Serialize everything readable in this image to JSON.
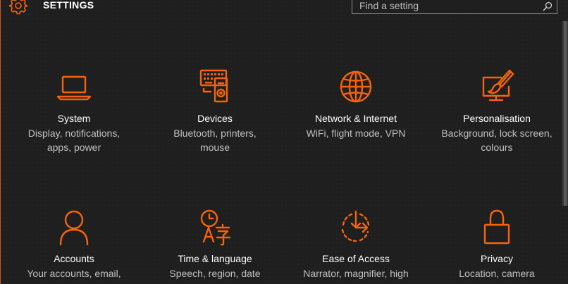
{
  "header": {
    "title": "SETTINGS",
    "gear_icon": "gear-icon"
  },
  "search": {
    "placeholder": "Find a setting",
    "icon": "search-icon"
  },
  "accent_color": "#f7630c",
  "tiles": [
    {
      "title": "System",
      "description": "Display, notifications, apps, power",
      "icon": "laptop-icon"
    },
    {
      "title": "Devices",
      "description": "Bluetooth, printers, mouse",
      "icon": "devices-icon"
    },
    {
      "title": "Network & Internet",
      "description": "WiFi, flight mode, VPN",
      "icon": "globe-icon"
    },
    {
      "title": "Personalisation",
      "description": "Background, lock screen, colours",
      "icon": "paintbrush-icon"
    },
    {
      "title": "Accounts",
      "description": "Your accounts, email, sync, work, other users",
      "icon": "person-icon"
    },
    {
      "title": "Time & language",
      "description": "Speech, region, date",
      "icon": "clock-language-icon"
    },
    {
      "title": "Ease of Access",
      "description": "Narrator, magnifier, high contrast",
      "icon": "ease-of-access-icon"
    },
    {
      "title": "Privacy",
      "description": "Location, camera",
      "icon": "lock-icon"
    }
  ]
}
